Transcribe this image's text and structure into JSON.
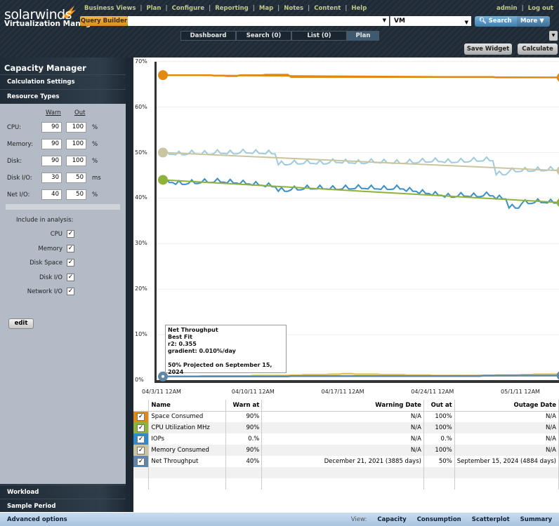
{
  "header": {
    "brand": "solarwinds",
    "product": "Virtualization Manager",
    "nav": [
      "Business Views",
      "Plan",
      "Configure",
      "Reporting",
      "Map",
      "Notes",
      "Content",
      "Help"
    ],
    "user": "admin",
    "logout": "Log out",
    "query_builder": "Query Builder",
    "search_value": "",
    "scope": "VM",
    "search_button": "Search",
    "more_button": "More"
  },
  "tabs": [
    {
      "label": "Dashboard"
    },
    {
      "label": "Search (0)"
    },
    {
      "label": "List (0)"
    },
    {
      "label": "Plan",
      "active": true
    }
  ],
  "actions": {
    "save_widget": "Save Widget",
    "calculate": "Calculate"
  },
  "sidebar": {
    "title": "Capacity Manager",
    "calculation_settings": "Calculation Settings",
    "resource_types": "Resource Types",
    "warn_header": "Warn",
    "out_header": "Out",
    "thresholds": [
      {
        "label": "CPU:",
        "warn": "90",
        "out": "100",
        "unit": "%"
      },
      {
        "label": "Memory:",
        "warn": "90",
        "out": "100",
        "unit": "%"
      },
      {
        "label": "Disk:",
        "warn": "90",
        "out": "100",
        "unit": "%"
      },
      {
        "label": "Disk I/O:",
        "warn": "30",
        "out": "50",
        "unit": "ms"
      },
      {
        "label": "Net I/O:",
        "warn": "40",
        "out": "50",
        "unit": "%"
      }
    ],
    "include_label": "Include in analysis:",
    "include": [
      {
        "label": "CPU",
        "checked": true
      },
      {
        "label": "Memory",
        "checked": true
      },
      {
        "label": "Disk Space",
        "checked": true
      },
      {
        "label": "Disk I/O",
        "checked": true
      },
      {
        "label": "Network I/O",
        "checked": true
      }
    ],
    "edit": "edit",
    "workload": "Workload",
    "sample_period": "Sample Period"
  },
  "chart_data": {
    "type": "line",
    "ylim": [
      0,
      70
    ],
    "yticks": [
      "0%",
      "10%",
      "20%",
      "30%",
      "40%",
      "50%",
      "60%",
      "70%"
    ],
    "xticks": [
      "04/3/11 12AM",
      "04/10/11 12AM",
      "04/17/11 12AM",
      "04/24/11 12AM",
      "05/1/11 12AM"
    ],
    "x_days": [
      "04/3/11",
      "04/4/11",
      "04/5/11",
      "04/6/11",
      "04/7/11",
      "04/8/11",
      "04/9/11",
      "04/10/11",
      "04/11/11",
      "04/12/11",
      "04/13/11",
      "04/14/11",
      "04/15/11",
      "04/16/11",
      "04/17/11",
      "04/18/11",
      "04/19/11",
      "04/20/11",
      "04/21/11",
      "04/22/11",
      "04/23/11",
      "04/24/11",
      "04/25/11",
      "04/26/11",
      "04/27/11",
      "04/28/11",
      "04/29/11",
      "04/30/11",
      "05/1/11",
      "05/2/11",
      "05/3/11",
      "05/4/11"
    ],
    "series": [
      {
        "name": "Space Consumed",
        "color": "#e08a14",
        "trend": [
          67,
          66.5
        ],
        "values": [
          67,
          67,
          67,
          67,
          66.9,
          66.8,
          67,
          67,
          67.1,
          67.1,
          66.6,
          66.6,
          66.6,
          66.6,
          66.6,
          66.6,
          66.6,
          66.6,
          66.6,
          66.6,
          66.6,
          66.6,
          66.6,
          66.6,
          66.6,
          66.6,
          66.5,
          66.5,
          66.5,
          66.5,
          66.5,
          66.5
        ]
      },
      {
        "name": "Memory Consumed",
        "color": "#c9c5a0",
        "raw_color": "#9fcbdc",
        "trend": [
          50,
          46
        ],
        "values": [
          49.6,
          49.5,
          49.7,
          49.6,
          49.8,
          49.7,
          49.9,
          49.8,
          49.7,
          47.3,
          47.5,
          47.6,
          47.5,
          47.8,
          47.7,
          47.6,
          47.8,
          47.7,
          47.6,
          47.7,
          47.9,
          48,
          47.8,
          47.9,
          48.1,
          48.2,
          45.1,
          45.8,
          45.9,
          46,
          46.1,
          46
        ]
      },
      {
        "name": "CPU Utilization MHz",
        "color": "#8fb23a",
        "raw_color": "#3a8fc8",
        "trend": [
          44,
          39
        ],
        "values": [
          43.4,
          43,
          43.2,
          43.4,
          43.5,
          43.3,
          43.1,
          42.8,
          42.5,
          41.5,
          41.8,
          42,
          42,
          41.9,
          42,
          42.1,
          42,
          41.9,
          42,
          41.5,
          41,
          40.6,
          40.2,
          40.4,
          40.3,
          40.5,
          39.8,
          37.8,
          38.8,
          39,
          38.9,
          39.2
        ]
      },
      {
        "name": "IOPs",
        "color": "#e3c25a",
        "values": [
          0.8,
          0.8,
          0.8,
          0.9,
          0.9,
          0.9,
          0.9,
          1,
          1,
          1,
          1.1,
          1.2,
          1.2,
          1.3,
          1.4,
          1.3,
          1.3,
          1.2,
          1.2,
          1.1,
          1.1,
          1,
          1,
          1,
          1,
          1,
          1.1,
          1.1,
          1.2,
          1.3,
          1.3,
          1.2
        ]
      },
      {
        "name": "Net Throughput",
        "color": "#5f88a8",
        "trend": [
          0.8,
          1
        ],
        "values": [
          0.8,
          0.8,
          0.8,
          0.8,
          0.8,
          0.8,
          0.8,
          0.8,
          0.8,
          0.8,
          0.9,
          0.9,
          0.9,
          0.9,
          0.9,
          0.9,
          0.9,
          0.9,
          0.9,
          0.9,
          0.9,
          0.9,
          0.9,
          0.9,
          0.9,
          1,
          1,
          1,
          1,
          1,
          1,
          1
        ]
      }
    ],
    "tooltip": {
      "title": "Net Throughput",
      "line1": "Best Fit",
      "line2": "r2: 0.355",
      "line3": "gradient: 0.010%/day",
      "line4": "50% Projected on September 15, 2024"
    }
  },
  "table": {
    "headers": [
      "Name",
      "Warn at",
      "Warning Date",
      "Out at",
      "Outage Date"
    ],
    "rows": [
      {
        "color": "#e08a14",
        "name": "Space Consumed",
        "warn": "90%",
        "warn_date": "N/A",
        "out": "100%",
        "out_date": "N/A"
      },
      {
        "color": "#8fb23a",
        "name": "CPU Utilization MHz",
        "warn": "90%",
        "warn_date": "N/A",
        "out": "100%",
        "out_date": "N/A"
      },
      {
        "color": "#2f8ad0",
        "name": "IOPs",
        "warn": "0.%",
        "warn_date": "N/A",
        "out": "0.%",
        "out_date": "N/A"
      },
      {
        "color": "#c9c5a0",
        "name": "Memory Consumed",
        "warn": "90%",
        "warn_date": "N/A",
        "out": "100%",
        "out_date": "N/A"
      },
      {
        "color": "#5f88a8",
        "name": "Net Throughput",
        "warn": "40%",
        "warn_date": "December 21, 2021 (3885 days)",
        "out": "50%",
        "out_date": "September 15, 2024 (4884 days)"
      }
    ]
  },
  "footer": {
    "advanced": "Advanced options",
    "view_label": "View:",
    "views": [
      "Capacity",
      "Consumption",
      "Scatterplot",
      "Summary"
    ]
  }
}
